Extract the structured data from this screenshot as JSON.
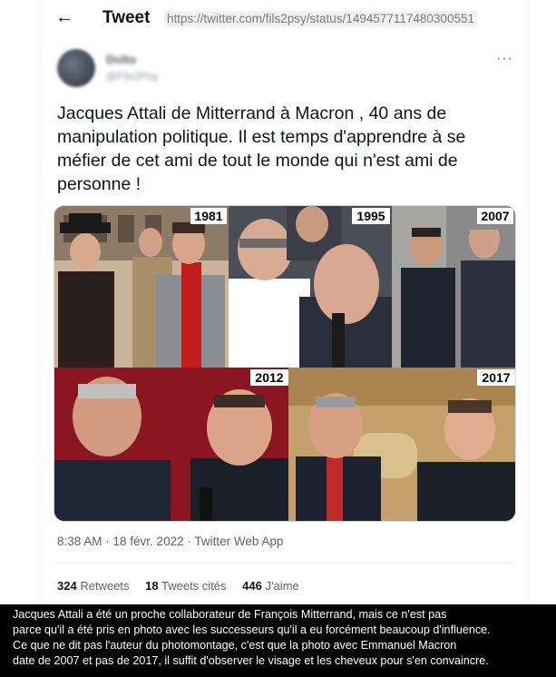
{
  "header": {
    "title": "Tweet",
    "url": "https://twitter.com/fils2psy/status/1494577117480300551"
  },
  "author": {
    "name": "Dolto",
    "handle": "@Fils2Psy"
  },
  "tweet": {
    "lines": [
      "Jacques Attali de Mitterrand à Macron , 40 ans de",
      "manipulation politique. Il est temps d'apprendre à se",
      "méfier de cet ami de tout le monde qui n'est ami de",
      "personne !"
    ],
    "timestamp": "8:38 AM · 18 févr. 2022 · Twitter Web App"
  },
  "photo_labels": [
    "1981",
    "1995",
    "2007",
    "2012",
    "2017"
  ],
  "stats": {
    "retweets_count": "324",
    "retweets_label": "Retweets",
    "quotes_count": "18",
    "quotes_label": "Tweets cités",
    "likes_count": "446",
    "likes_label": "J'aime"
  },
  "caption": {
    "lines": [
      "Jacques Attali a été un proche collaborateur de François Mitterrand, mais ce n'est pas",
      "parce qu'il a été pris en photo avec les successeurs qu'il a eu forcément beaucoup d'influence.",
      "Ce que ne dit pas l'auteur du photomontage, c'est que la photo avec Emmanuel Macron",
      "date de 2007 et pas de 2017, il suffit d'observer le visage et les cheveux pour s'en  convaincre."
    ]
  }
}
